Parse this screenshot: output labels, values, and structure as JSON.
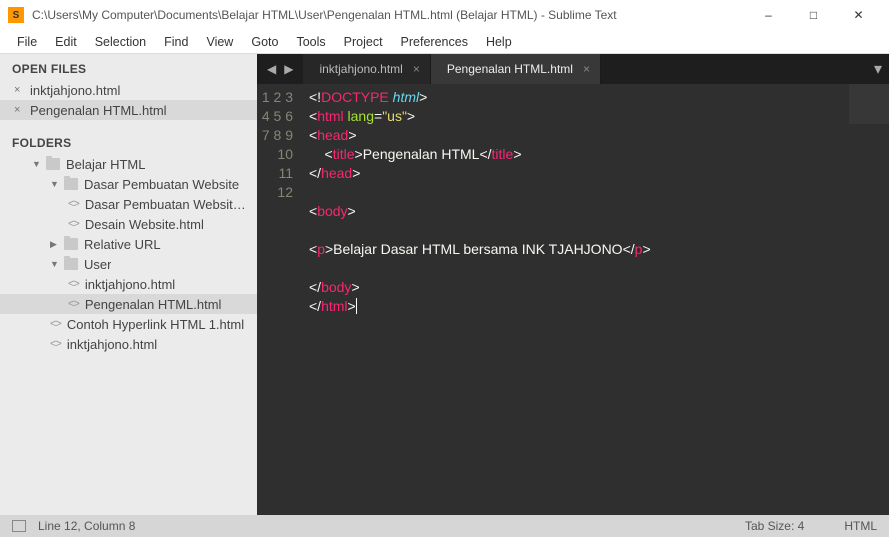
{
  "window": {
    "title": "C:\\Users\\My Computer\\Documents\\Belajar HTML\\User\\Pengenalan HTML.html (Belajar HTML) - Sublime Text",
    "app_icon_letter": "S"
  },
  "menu": [
    "File",
    "Edit",
    "Selection",
    "Find",
    "View",
    "Goto",
    "Tools",
    "Project",
    "Preferences",
    "Help"
  ],
  "sidebar": {
    "open_files_header": "OPEN FILES",
    "open_files": [
      {
        "name": "inktjahjono.html",
        "active": false
      },
      {
        "name": "Pengenalan HTML.html",
        "active": true
      }
    ],
    "folders_header": "FOLDERS",
    "tree": [
      {
        "type": "folder",
        "name": "Belajar HTML",
        "depth": 0,
        "open": true
      },
      {
        "type": "folder",
        "name": "Dasar Pembuatan Website",
        "depth": 1,
        "open": true
      },
      {
        "type": "file",
        "name": "Dasar Pembuatan Website.html",
        "depth": 2
      },
      {
        "type": "file",
        "name": "Desain Website.html",
        "depth": 2
      },
      {
        "type": "folder",
        "name": "Relative URL",
        "depth": 1,
        "open": false
      },
      {
        "type": "folder",
        "name": "User",
        "depth": 1,
        "open": true
      },
      {
        "type": "file",
        "name": "inktjahjono.html",
        "depth": 2
      },
      {
        "type": "file",
        "name": "Pengenalan HTML.html",
        "depth": 2,
        "active": true
      },
      {
        "type": "file",
        "name": "Contoh Hyperlink HTML 1.html",
        "depth": 1
      },
      {
        "type": "file",
        "name": "inktjahjono.html",
        "depth": 1
      }
    ]
  },
  "tabs": [
    {
      "label": "inktjahjono.html",
      "active": false
    },
    {
      "label": "Pengenalan HTML.html",
      "active": true
    }
  ],
  "code": {
    "line_count": 12,
    "lines": [
      [
        {
          "t": "<!",
          "c": "white"
        },
        {
          "t": "DOCTYPE",
          "c": "red"
        },
        {
          "t": " ",
          "c": "white"
        },
        {
          "t": "html",
          "c": "blue"
        },
        {
          "t": ">",
          "c": "white"
        }
      ],
      [
        {
          "t": "<",
          "c": "white"
        },
        {
          "t": "html",
          "c": "red"
        },
        {
          "t": " ",
          "c": "white"
        },
        {
          "t": "lang",
          "c": "green"
        },
        {
          "t": "=",
          "c": "white"
        },
        {
          "t": "\"us\"",
          "c": "yellow"
        },
        {
          "t": ">",
          "c": "white"
        }
      ],
      [
        {
          "t": "<",
          "c": "white"
        },
        {
          "t": "head",
          "c": "red"
        },
        {
          "t": ">",
          "c": "white"
        }
      ],
      [
        {
          "t": "    <",
          "c": "white"
        },
        {
          "t": "title",
          "c": "red"
        },
        {
          "t": ">Pengenalan HTML</",
          "c": "white"
        },
        {
          "t": "title",
          "c": "red"
        },
        {
          "t": ">",
          "c": "white"
        }
      ],
      [
        {
          "t": "</",
          "c": "white"
        },
        {
          "t": "head",
          "c": "red"
        },
        {
          "t": ">",
          "c": "white"
        }
      ],
      [],
      [
        {
          "t": "<",
          "c": "white"
        },
        {
          "t": "body",
          "c": "red"
        },
        {
          "t": ">",
          "c": "white"
        }
      ],
      [],
      [
        {
          "t": "<",
          "c": "white"
        },
        {
          "t": "p",
          "c": "red"
        },
        {
          "t": ">Belajar Dasar HTML bersama INK TJAHJONO</",
          "c": "white"
        },
        {
          "t": "p",
          "c": "red"
        },
        {
          "t": ">",
          "c": "white"
        }
      ],
      [],
      [
        {
          "t": "</",
          "c": "white"
        },
        {
          "t": "body",
          "c": "red"
        },
        {
          "t": ">",
          "c": "white"
        }
      ],
      [
        {
          "t": "</",
          "c": "white"
        },
        {
          "t": "html",
          "c": "red"
        },
        {
          "t": ">",
          "c": "white"
        },
        {
          "t": "",
          "c": "cursor"
        }
      ]
    ]
  },
  "statusbar": {
    "position": "Line 12, Column 8",
    "tab_size": "Tab Size: 4",
    "syntax": "HTML"
  }
}
